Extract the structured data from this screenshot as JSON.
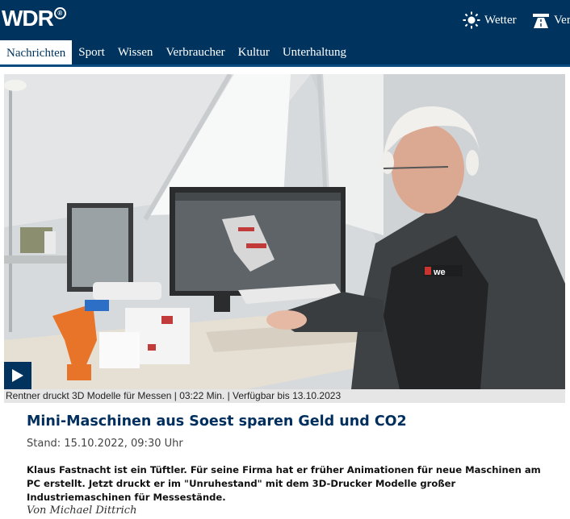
{
  "header": {
    "logo": "WDR",
    "logo_reg": "®",
    "weather_label": "Wetter",
    "traffic_label": "Ver"
  },
  "nav": {
    "items": [
      {
        "label": "Nachrichten",
        "active": true
      },
      {
        "label": "Sport"
      },
      {
        "label": "Wissen"
      },
      {
        "label": "Verbraucher"
      },
      {
        "label": "Kultur"
      },
      {
        "label": "Unterhaltung"
      }
    ]
  },
  "video": {
    "caption": "Rentner druckt 3D Modelle für Messen | 03:22 Min. | Verfügbar bis 13.10.2023",
    "shirt_logo": "we",
    "play_icon": "play-icon"
  },
  "article": {
    "headline": "Mini-Maschinen aus Soest sparen Geld und CO2",
    "date": "Stand: 15.10.2022, 09:30 Uhr",
    "lead": "Klaus Fastnacht ist ein Tüftler. Für seine Firma hat er früher Animationen für neue Maschinen am PC erstellt. Jetzt druckt er im \"Unruhestand\" mit dem 3D-Drucker Modelle großer Industriemaschinen für Messestände.",
    "author": "Von Michael Dittrich"
  },
  "colors": {
    "brand_navy": "#00345e",
    "headline": "#002f5e"
  }
}
